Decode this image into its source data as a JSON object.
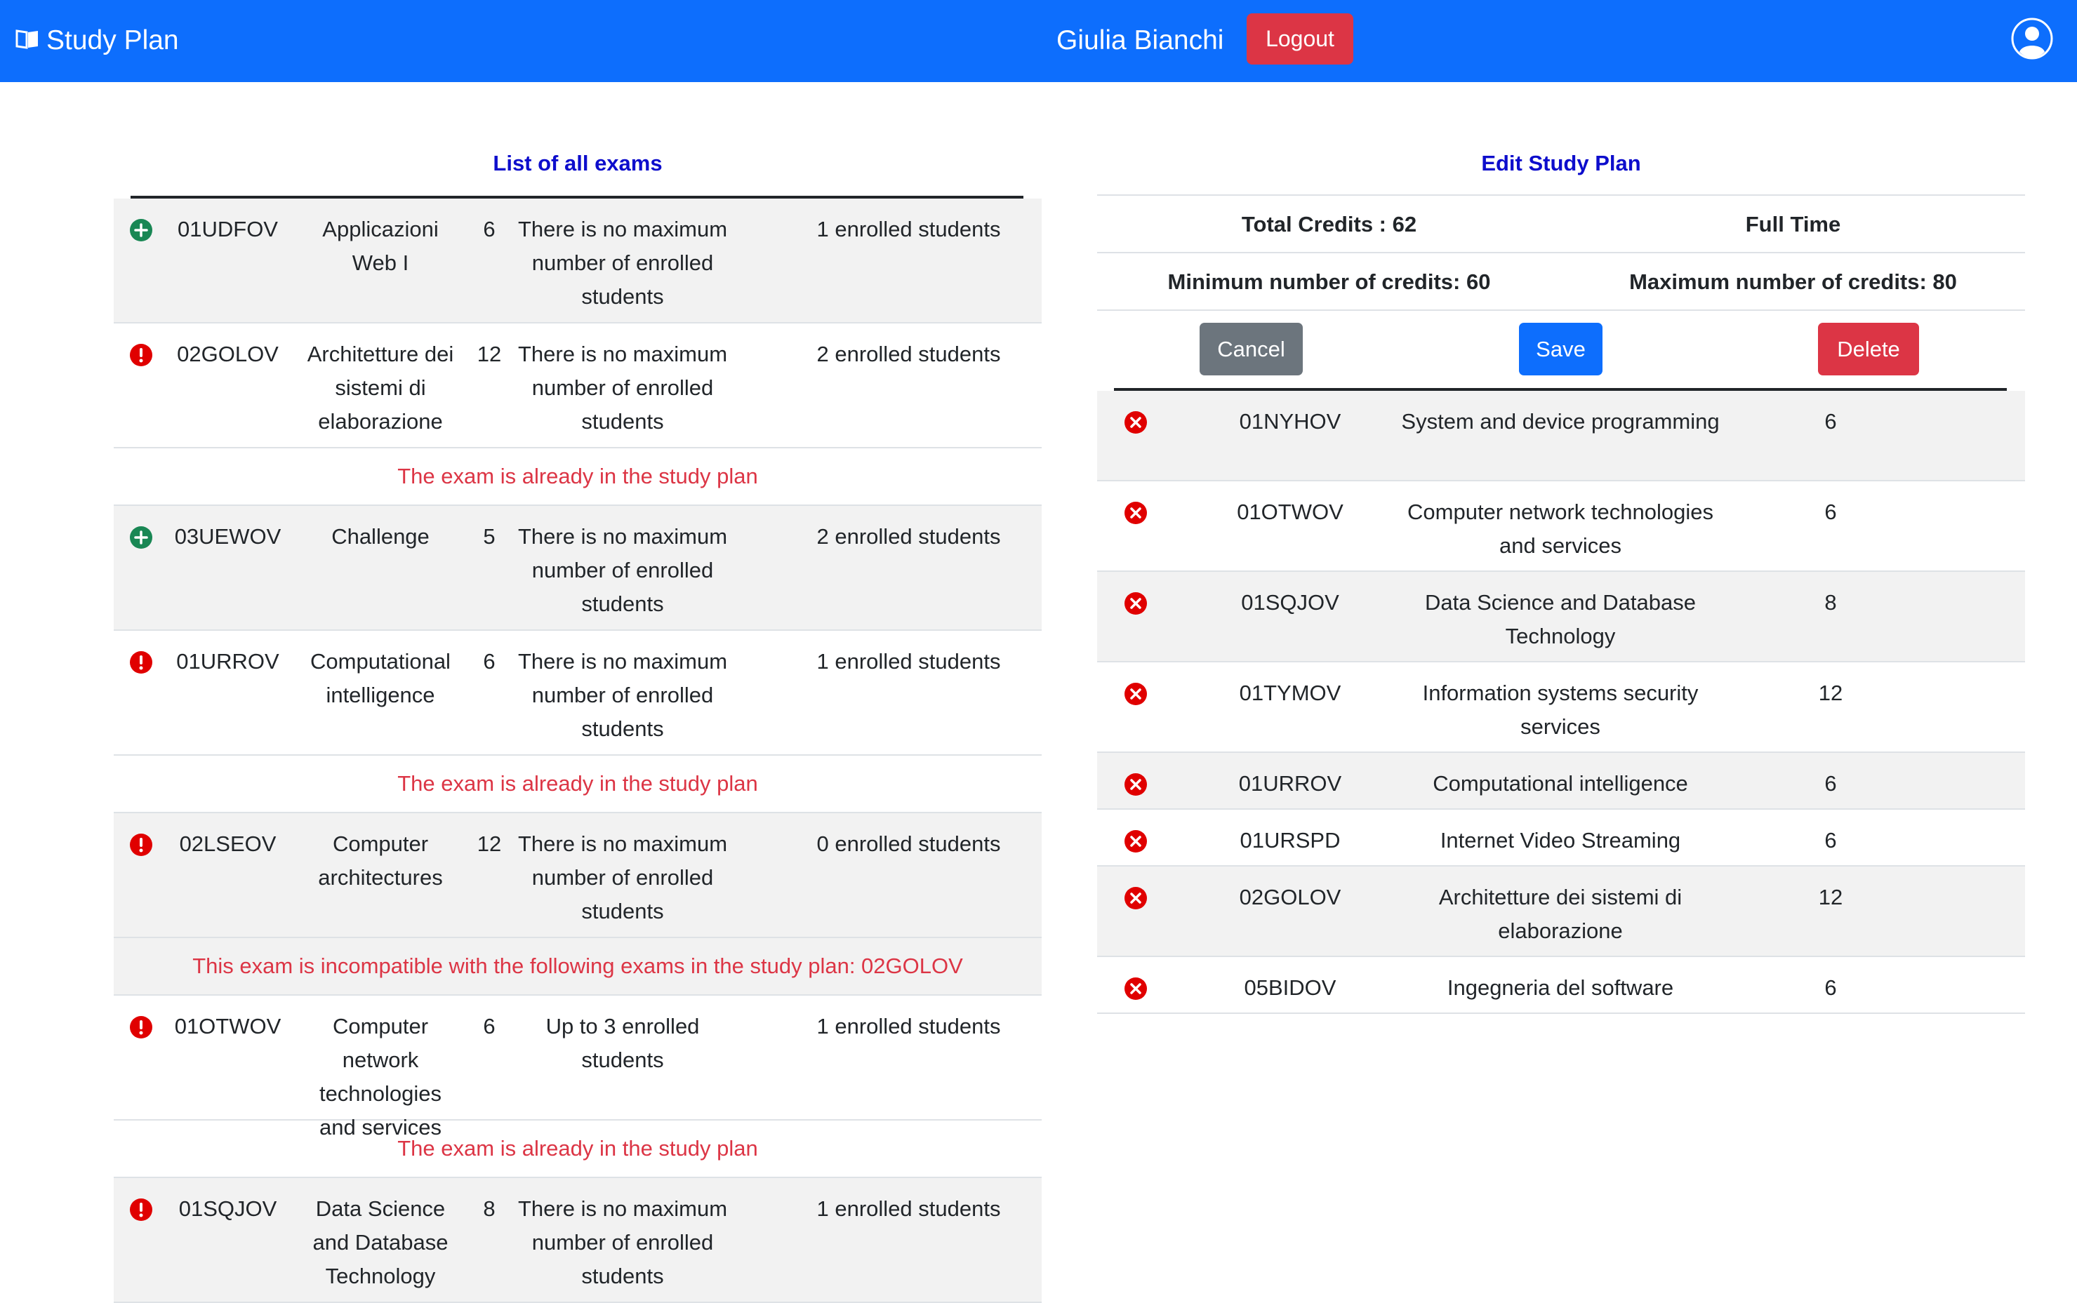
{
  "navbar": {
    "brand": "Study Plan",
    "brand_icon": "book-icon",
    "username": "Giulia Bianchi",
    "logout_label": "Logout",
    "user_icon": "user-circle-icon",
    "color": "#0d6efd"
  },
  "left": {
    "title": "List of all exams",
    "rows": [
      {
        "kind": "exam",
        "shade": true,
        "icon": "plus-circle-icon",
        "code": "01UDFOV",
        "name": "Applicazioni Web I",
        "credits": "6",
        "max": "There is no maximum number of enrolled students",
        "enrolled": "1 enrolled students"
      },
      {
        "kind": "exam",
        "shade": false,
        "icon": "exclamation-circle-icon",
        "code": "02GOLOV",
        "name": "Architetture dei sistemi di elaborazione",
        "credits": "12",
        "max": "There is no maximum number of enrolled students",
        "enrolled": "2 enrolled students"
      },
      {
        "kind": "msg",
        "shade": false,
        "text": "The exam is already in the study plan"
      },
      {
        "kind": "exam",
        "shade": true,
        "icon": "plus-circle-icon",
        "code": "03UEWOV",
        "name": "Challenge",
        "credits": "5",
        "max": "There is no maximum number of enrolled students",
        "enrolled": "2 enrolled students"
      },
      {
        "kind": "exam",
        "shade": false,
        "icon": "exclamation-circle-icon",
        "code": "01URROV",
        "name": "Computational intelligence",
        "credits": "6",
        "max": "There is no maximum number of enrolled students",
        "enrolled": "1 enrolled students"
      },
      {
        "kind": "msg",
        "shade": false,
        "text": "The exam is already in the study plan"
      },
      {
        "kind": "exam",
        "shade": true,
        "icon": "exclamation-circle-icon",
        "code": "02LSEOV",
        "name": "Computer architectures",
        "credits": "12",
        "max": "There is no maximum number of enrolled students",
        "enrolled": "0 enrolled students"
      },
      {
        "kind": "msg",
        "shade": true,
        "text": "This exam is incompatible with the following exams in the study plan: 02GOLOV"
      },
      {
        "kind": "exam",
        "shade": false,
        "icon": "exclamation-circle-icon",
        "code": "01OTWOV",
        "name": "Computer network technologies and services",
        "credits": "6",
        "max": "Up to 3 enrolled students",
        "enrolled": "1 enrolled students"
      },
      {
        "kind": "msg",
        "shade": false,
        "text": "The exam is already in the study plan"
      },
      {
        "kind": "exam",
        "shade": true,
        "icon": "exclamation-circle-icon",
        "code": "01SQJOV",
        "name": "Data Science and Database Technology",
        "credits": "8",
        "max": "There is no maximum number of enrolled students",
        "enrolled": "1 enrolled students"
      }
    ]
  },
  "right": {
    "title": "Edit Study Plan",
    "total_credits": "Total Credits : 62",
    "mode": "Full Time",
    "min_credits": "Minimum number of credits: 60",
    "max_credits": "Maximum number of credits: 80",
    "cancel_label": "Cancel",
    "save_label": "Save",
    "delete_label": "Delete",
    "rows": [
      {
        "code": "01NYHOV",
        "name": "System and device programming",
        "credits": "6"
      },
      {
        "code": "01OTWOV",
        "name": "Computer network technologies and services",
        "credits": "6"
      },
      {
        "code": "01SQJOV",
        "name": "Data Science and Database Technology",
        "credits": "8"
      },
      {
        "code": "01TYMOV",
        "name": "Information systems security services",
        "credits": "12"
      },
      {
        "code": "01URROV",
        "name": "Computational intelligence",
        "credits": "6"
      },
      {
        "code": "01URSPD",
        "name": "Internet Video Streaming",
        "credits": "6"
      },
      {
        "code": "02GOLOV",
        "name": "Architetture dei sistemi di elaborazione",
        "credits": "12"
      },
      {
        "code": "05BIDOV",
        "name": "Ingegneria del software",
        "credits": "6"
      }
    ],
    "remove_icon": "x-circle-icon"
  },
  "colors": {
    "primary": "#0d6efd",
    "danger": "#dc3545",
    "success": "#198754",
    "secondary": "#6c757d",
    "title": "#0d0dcc"
  }
}
